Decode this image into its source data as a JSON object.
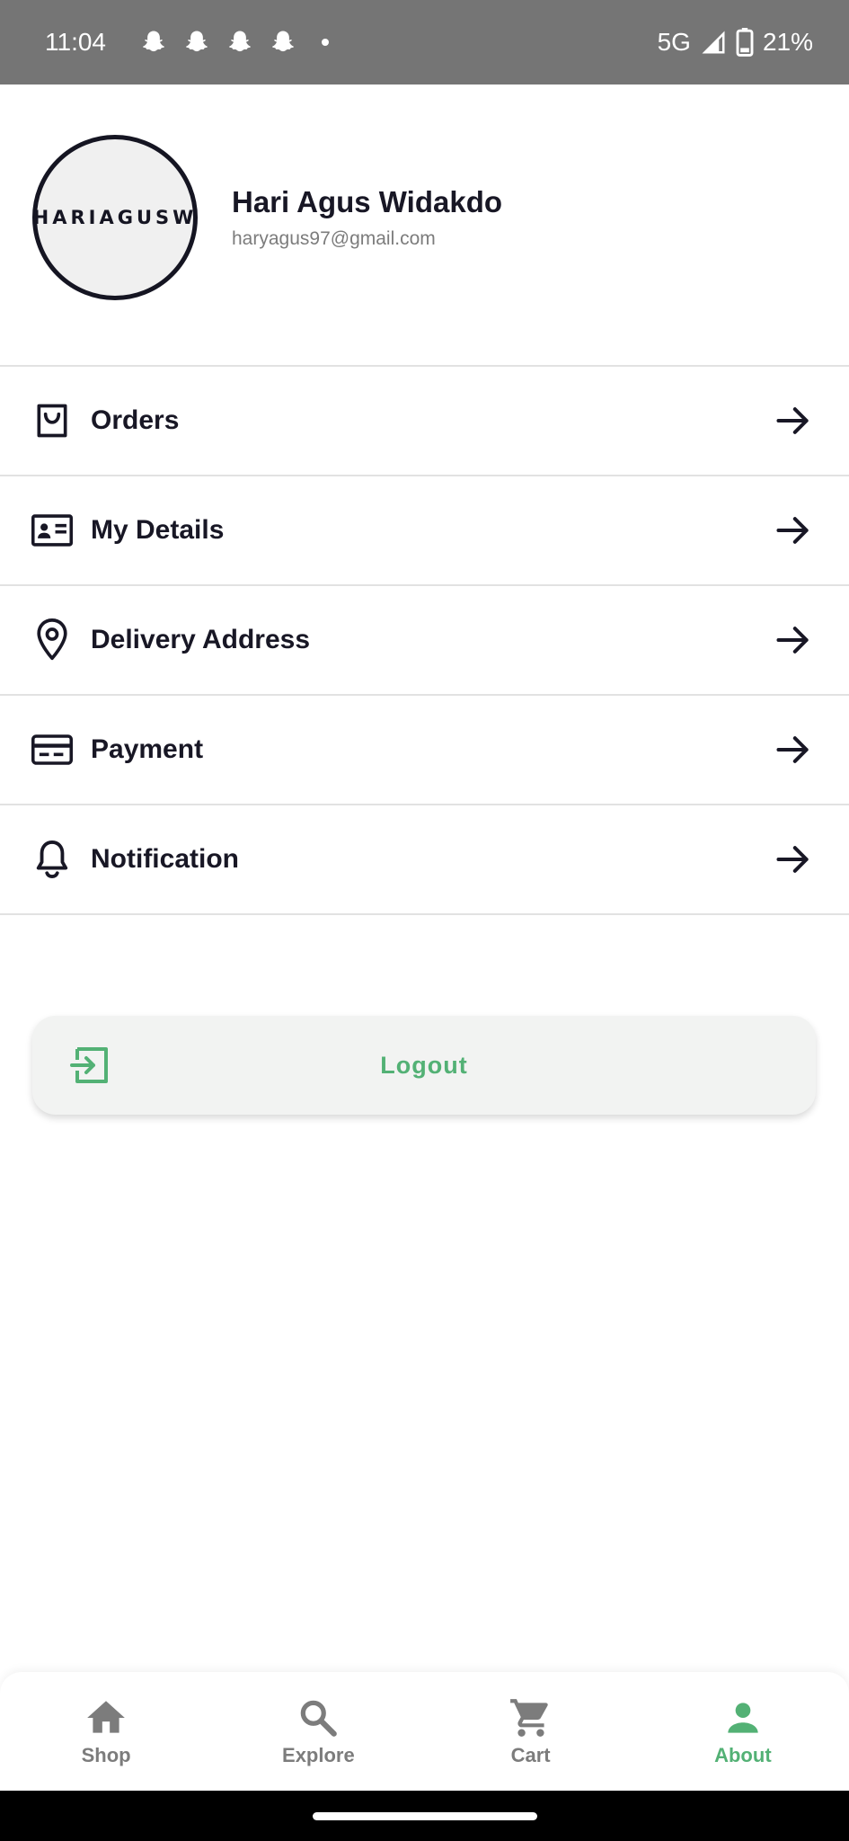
{
  "status_bar": {
    "time": "11:04",
    "network": "5G",
    "battery": "21%",
    "notification_icons": [
      "snapchat-icon",
      "snapchat-icon",
      "snapchat-icon",
      "snapchat-icon"
    ]
  },
  "profile": {
    "avatar_text": "HARIAGUSW",
    "name": "Hari Agus Widakdo",
    "email": "haryagus97@gmail.com"
  },
  "menu": {
    "items": [
      {
        "label": "Orders",
        "icon": "shopping-bag-icon"
      },
      {
        "label": "My Details",
        "icon": "id-card-icon"
      },
      {
        "label": "Delivery Address",
        "icon": "location-pin-icon"
      },
      {
        "label": "Payment",
        "icon": "credit-card-icon"
      },
      {
        "label": "Notification",
        "icon": "bell-icon"
      }
    ]
  },
  "logout": {
    "label": "Logout",
    "icon": "logout-icon"
  },
  "bottom_nav": {
    "items": [
      {
        "label": "Shop",
        "icon": "home-icon",
        "active": false
      },
      {
        "label": "Explore",
        "icon": "search-icon",
        "active": false
      },
      {
        "label": "Cart",
        "icon": "cart-icon",
        "active": false
      },
      {
        "label": "About",
        "icon": "person-icon",
        "active": true
      }
    ]
  },
  "colors": {
    "accent": "#53b175",
    "text_primary": "#181725",
    "text_secondary": "#7c7c7c",
    "status_bar": "#757575"
  }
}
